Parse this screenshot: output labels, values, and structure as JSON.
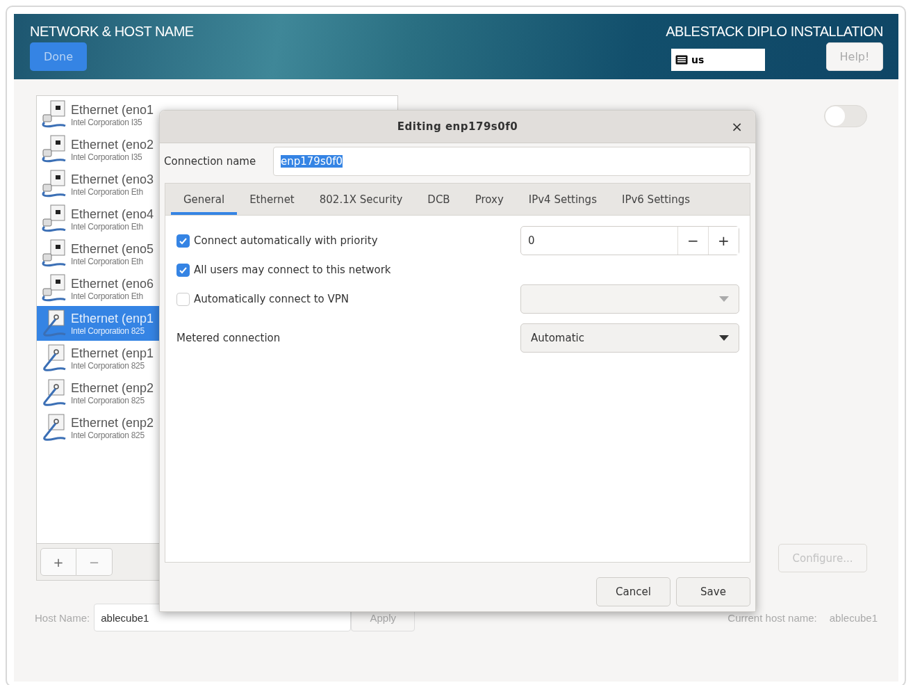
{
  "header": {
    "title": "NETWORK & HOST NAME",
    "done_button": "Done",
    "product": "ABLESTACK DIPLO INSTALLATION",
    "keyboard_layout": "us",
    "help_button": "Help!"
  },
  "connections": [
    {
      "title": "Ethernet (eno1",
      "subtitle": "Intel Corporation I35",
      "kind": "jack",
      "selected": false
    },
    {
      "title": "Ethernet (eno2",
      "subtitle": "Intel Corporation I35",
      "kind": "jack",
      "selected": false
    },
    {
      "title": "Ethernet (eno3",
      "subtitle": "Intel Corporation Eth",
      "kind": "jack",
      "selected": false
    },
    {
      "title": "Ethernet (eno4",
      "subtitle": "Intel Corporation Eth",
      "kind": "jack",
      "selected": false
    },
    {
      "title": "Ethernet (eno5",
      "subtitle": "Intel Corporation Eth",
      "kind": "jack",
      "selected": false
    },
    {
      "title": "Ethernet (eno6",
      "subtitle": "Intel Corporation Eth",
      "kind": "jack",
      "selected": false
    },
    {
      "title": "Ethernet (enp1",
      "subtitle": "Intel Corporation 825",
      "kind": "cable",
      "selected": true
    },
    {
      "title": "Ethernet (enp1",
      "subtitle": "Intel Corporation 825",
      "kind": "cable",
      "selected": false
    },
    {
      "title": "Ethernet (enp2",
      "subtitle": "Intel Corporation 825",
      "kind": "cable",
      "selected": false
    },
    {
      "title": "Ethernet (enp2",
      "subtitle": "Intel Corporation 825",
      "kind": "cable",
      "selected": false
    }
  ],
  "list_buttons": [
    {
      "label": "+",
      "disabled": false
    },
    {
      "label": "−",
      "disabled": true
    }
  ],
  "device_toggle": {
    "on": false
  },
  "configure_button": {
    "label": "Configure...",
    "disabled": true
  },
  "host_name": {
    "label": "Host Name:",
    "value": "ablecube1",
    "apply_button": "Apply"
  },
  "current_host": {
    "label": "Current host name:",
    "value": "ablecube1"
  },
  "dialog": {
    "title": "Editing enp179s0f0",
    "close": "×",
    "connection_name": {
      "label": "Connection name",
      "value": "enp179s0f0"
    },
    "tabs": [
      {
        "label": "General",
        "selected": true
      },
      {
        "label": "Ethernet",
        "selected": false
      },
      {
        "label": "802.1X Security",
        "selected": false
      },
      {
        "label": "DCB",
        "selected": false
      },
      {
        "label": "Proxy",
        "selected": false
      },
      {
        "label": "IPv4 Settings",
        "selected": false
      },
      {
        "label": "IPv6 Settings",
        "selected": false
      }
    ],
    "options": [
      {
        "label": "Connect automatically with priority",
        "checked": true
      },
      {
        "label": "All users may connect to this network",
        "checked": true
      },
      {
        "label": "Automatically connect to VPN",
        "checked": false
      }
    ],
    "priority": {
      "value": "0",
      "minus": "−",
      "plus": "+"
    },
    "metered": {
      "label": "Metered connection",
      "value": "Automatic"
    },
    "buttons": [
      "Cancel",
      "Save"
    ]
  }
}
